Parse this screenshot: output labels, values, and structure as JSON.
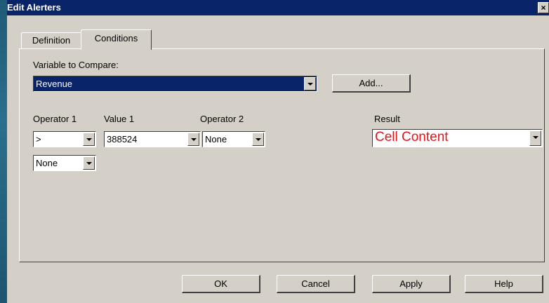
{
  "window": {
    "title": "Edit Alerters",
    "close_label": "×"
  },
  "tabs": [
    {
      "label": "Definition",
      "active": false
    },
    {
      "label": "Conditions",
      "active": true
    }
  ],
  "variable": {
    "label": "Variable to Compare:",
    "value": "Revenue",
    "add_label": "Add..."
  },
  "operator1": {
    "label": "Operator 1",
    "value": ">"
  },
  "value1": {
    "label": "Value 1",
    "value": "388524"
  },
  "operator2": {
    "label": "Operator 2",
    "value": "None"
  },
  "extra_operator": {
    "value": "None"
  },
  "result": {
    "label": "Result",
    "value": "Cell Content",
    "color": "#e8141a"
  },
  "footer": {
    "ok": "OK",
    "cancel": "Cancel",
    "apply": "Apply",
    "help": "Help"
  },
  "colors": {
    "titlebar": "#0a246a",
    "dialog": "#d4d0c8"
  }
}
